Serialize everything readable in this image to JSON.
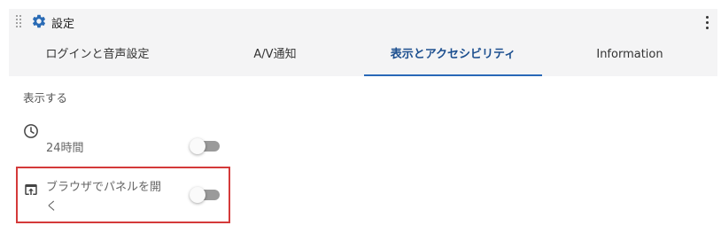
{
  "header": {
    "title": "設定",
    "drag_icon": "drag-handle-icon",
    "settings_icon": "gear-icon",
    "menu_icon": "more-vertical-icon"
  },
  "tabs": [
    {
      "label": "ログインと音声設定",
      "active": false
    },
    {
      "label": "A/V通知",
      "active": false
    },
    {
      "label": "表示とアクセシビリティ",
      "active": true
    },
    {
      "label": "Information",
      "active": false
    }
  ],
  "display": {
    "section_label": "表示する",
    "clock_24h": {
      "icon": "clock-icon",
      "label": "24時間",
      "enabled": false
    },
    "open_panel_in_browser": {
      "icon": "open-in-browser-icon",
      "label_line1": "ブラウザでパネルを開",
      "label_line2": "く",
      "enabled": false
    }
  },
  "colors": {
    "accent": "#2968b8",
    "active_tab_text": "#1c4f8f",
    "header_bg": "#f4f4f5",
    "highlight_border": "#d43a3a",
    "toggle_off_track": "#9a9a9a"
  }
}
